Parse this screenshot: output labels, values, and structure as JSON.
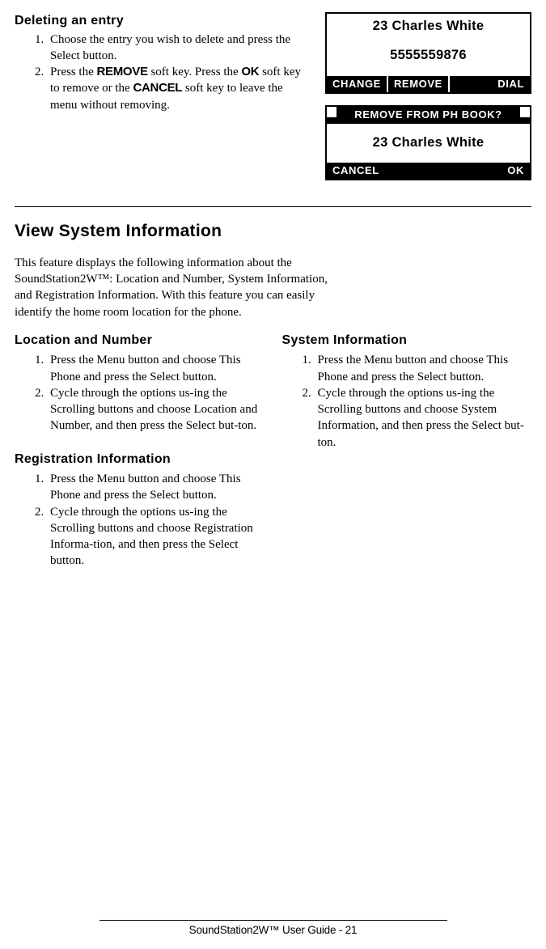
{
  "deleting": {
    "heading": "Deleting an entry",
    "step1": "Choose the entry you wish to delete and press the Select button.",
    "step2_a": "Press the ",
    "step2_remove": "REMOVE",
    "step2_b": " soft key.  Press the ",
    "step2_ok": "OK",
    "step2_c": " soft key to remove or the ",
    "step2_cancel": "CANCEL",
    "step2_d": " soft key to leave the menu without removing."
  },
  "lcd1": {
    "line1": "23 Charles White",
    "line2": "5555559876",
    "soft1": "CHANGE",
    "soft2": "REMOVE",
    "soft3": "DIAL"
  },
  "lcd2": {
    "title": "REMOVE FROM PH BOOK?",
    "line1": "23 Charles White",
    "soft1": "CANCEL",
    "soft2": "OK"
  },
  "view": {
    "heading": "View System Information",
    "intro": "This feature displays the following information about the SoundStation2W™: Location and Number, System Information, and Registration Information.  With this feature you can easily identify the home room location for the phone."
  },
  "loc": {
    "heading": "Location and Number",
    "s1": "Press the Menu button and choose This Phone and press the Select button.",
    "s2": "Cycle through the options us-ing the Scrolling buttons and choose Location and Number, and then press the Select but-ton."
  },
  "sys": {
    "heading": "System Information",
    "s1": "Press the Menu button and choose This Phone and press the Select button.",
    "s2": "Cycle through the options us-ing the Scrolling buttons and choose System Information, and then press the Select but-ton."
  },
  "reg": {
    "heading": "Registration Information",
    "s1": "Press the Menu button and choose This Phone and press the Select button.",
    "s2": "Cycle through the options us-ing the Scrolling buttons and choose Registration Informa-tion, and then press the Select button."
  },
  "footer": "SoundStation2W™ User Guide - 21"
}
